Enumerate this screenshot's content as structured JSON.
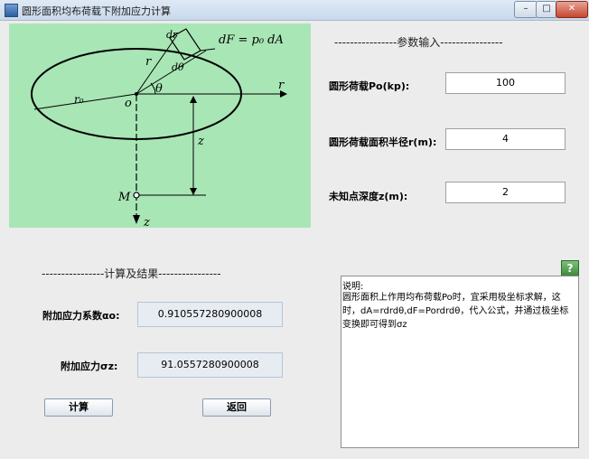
{
  "window": {
    "title": "圆形面积均布荷载下附加应力计算",
    "min_symbol": "–",
    "max_symbol": "□",
    "close_symbol": "✕"
  },
  "diagram": {
    "labels": {
      "df_formula": "dF = p₀ dA",
      "r": "r",
      "d_theta": "dθ",
      "dr": "dr",
      "theta": "θ",
      "r_axis": "r",
      "r0": "r₀",
      "origin": "o",
      "z_depth": "z",
      "point_m": "M",
      "z_axis": "z"
    },
    "fill_color": "#a8e6b5"
  },
  "params": {
    "section_title": "----------------参数输入----------------",
    "load_label": "圆形荷载Po(kp):",
    "load_value": "100",
    "radius_label": "圆形荷载面积半径r(m):",
    "radius_value": "4",
    "depth_label": "未知点深度z(m):",
    "depth_value": "2"
  },
  "results": {
    "section_title": "----------------计算及结果----------------",
    "coef_label": "附加应力系数αo:",
    "coef_value": "0.910557280900008",
    "stress_label": "附加应力σz:",
    "stress_value": "91.0557280900008"
  },
  "buttons": {
    "calculate": "计算",
    "back": "返回",
    "help": "?"
  },
  "notes": {
    "title": "说明:",
    "body": "圆形面积上作用均布荷载Po时，宜采用极坐标求解，这时，dA=rdrdθ,dF=Pordrdθ，代入公式，并通过极坐标变换即可得到σz"
  }
}
